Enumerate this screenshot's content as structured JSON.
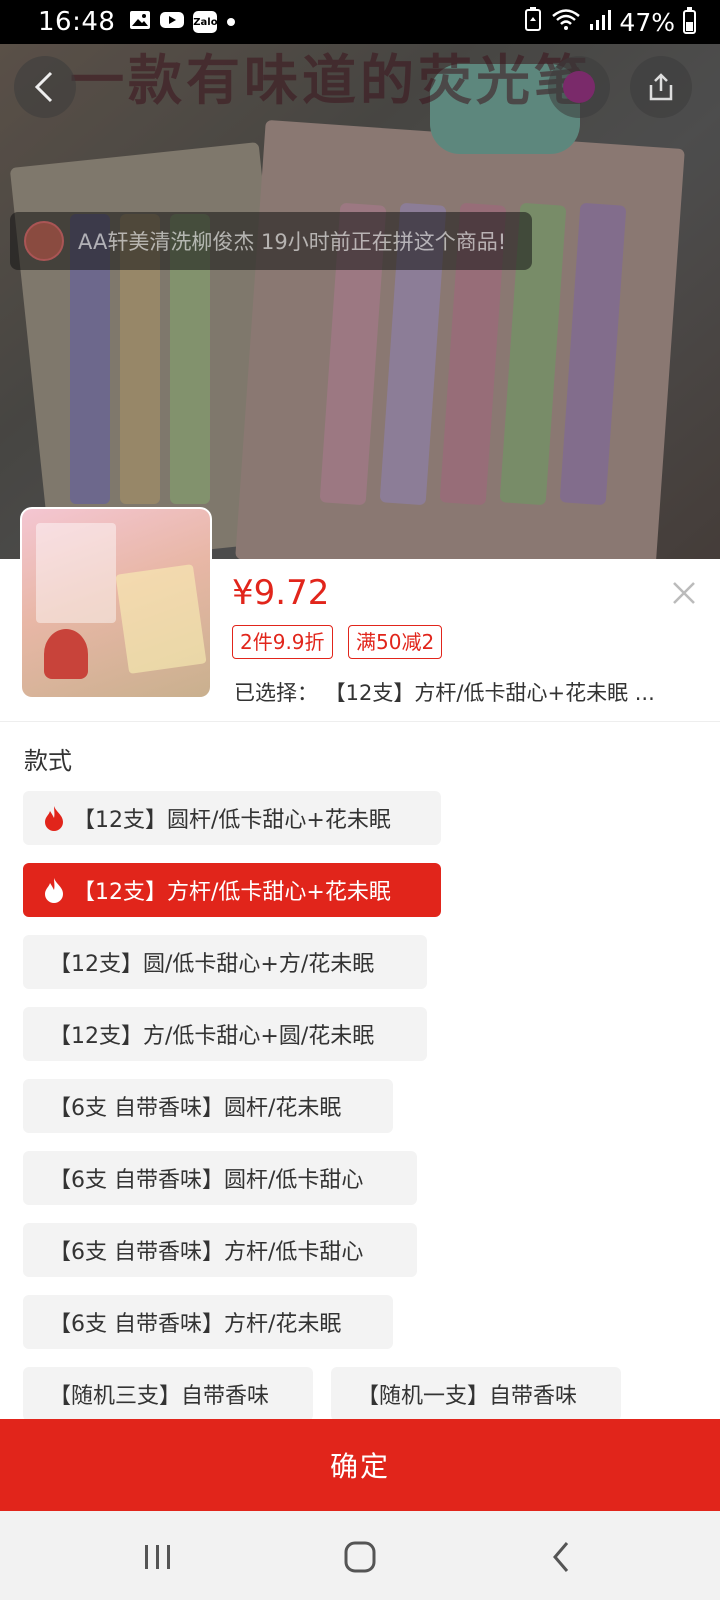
{
  "status_bar": {
    "time": "16:48",
    "app_icons": [
      "image-icon",
      "youtube-icon",
      "zalo-icon",
      "dot-icon"
    ],
    "zalo_text": "Zalo",
    "battery_text": "47%",
    "battery_level": 0.47
  },
  "hero": {
    "banner_text": "一款有味道的荧光笔",
    "toast_text": "AA轩美清洗柳俊杰 19小时前正在拼这个商品!"
  },
  "product": {
    "price": "¥9.72",
    "tags": [
      "2件9.9折",
      "满50减2"
    ],
    "selected_text": "已选择： 【12支】方杆/低卡甜心+花未眠 ..."
  },
  "section": {
    "title": "款式"
  },
  "options": [
    {
      "label": "【12支】圆杆/低卡甜心+花未眠",
      "hot": true,
      "selected": false
    },
    {
      "label": "【12支】方杆/低卡甜心+花未眠",
      "hot": true,
      "selected": true
    },
    {
      "label": "【12支】圆/低卡甜心+方/花未眠",
      "hot": false,
      "selected": false
    },
    {
      "label": "【12支】方/低卡甜心+圆/花未眠",
      "hot": false,
      "selected": false
    },
    {
      "label": "【6支 自带香味】圆杆/花未眠",
      "hot": false,
      "selected": false
    },
    {
      "label": "【6支 自带香味】圆杆/低卡甜心",
      "hot": false,
      "selected": false
    },
    {
      "label": "【6支 自带香味】方杆/低卡甜心",
      "hot": false,
      "selected": false
    },
    {
      "label": "【6支 自带香味】方杆/花未眠",
      "hot": false,
      "selected": false
    },
    {
      "label": "【随机三支】自带香味",
      "hot": false,
      "selected": false
    },
    {
      "label": "【随机一支】自带香味",
      "hot": false,
      "selected": false
    }
  ],
  "confirm_label": "确定",
  "colors": {
    "accent": "#e1251b",
    "chip_bg": "#f3f3f3"
  }
}
